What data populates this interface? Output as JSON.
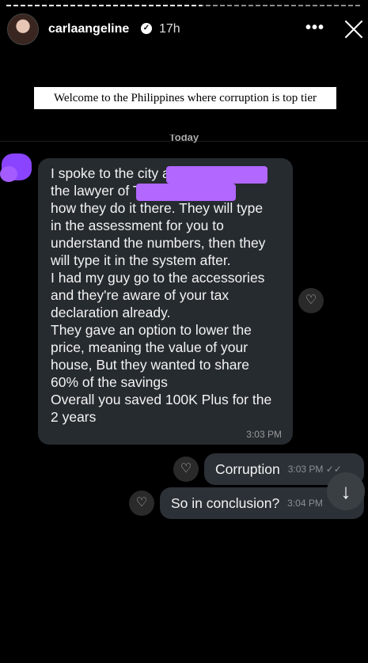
{
  "story": {
    "username": "carlaangeline",
    "verified_glyph": "✓",
    "age": "17h",
    "more_glyph": "•••",
    "caption": "Welcome to the Philippines where corruption is top tier",
    "progress_fraction": 0.55
  },
  "chat": {
    "date_header": "Today",
    "incoming": {
      "text": "I spoke to the city            and\nthe lawyer of                   That's\nhow they do it there. They will type\nin the assessment for you to\nunderstand the numbers, then they\nwill type it in the system after.\nI had my guy go to the accessories\nand they're aware of your tax\ndeclaration already.\nThey gave an option to lower the\nprice, meaning the value of your\nhouse, But they wanted to share\n60% of the savings\nOverall you saved 100K Plus for the\n2 years",
      "time": "3:03 PM"
    },
    "outgoing": [
      {
        "text": "Corruption",
        "time": "3:03 PM ✓✓"
      },
      {
        "text": "So in conclusion?",
        "time": "3:04 PM"
      }
    ],
    "heart_glyph": "♡",
    "scroll_glyph": "↓"
  },
  "colors": {
    "background": "#000000",
    "incoming_bubble": "#262b30",
    "outgoing_bubble": "#2c3137",
    "redaction": "#b267ff"
  }
}
